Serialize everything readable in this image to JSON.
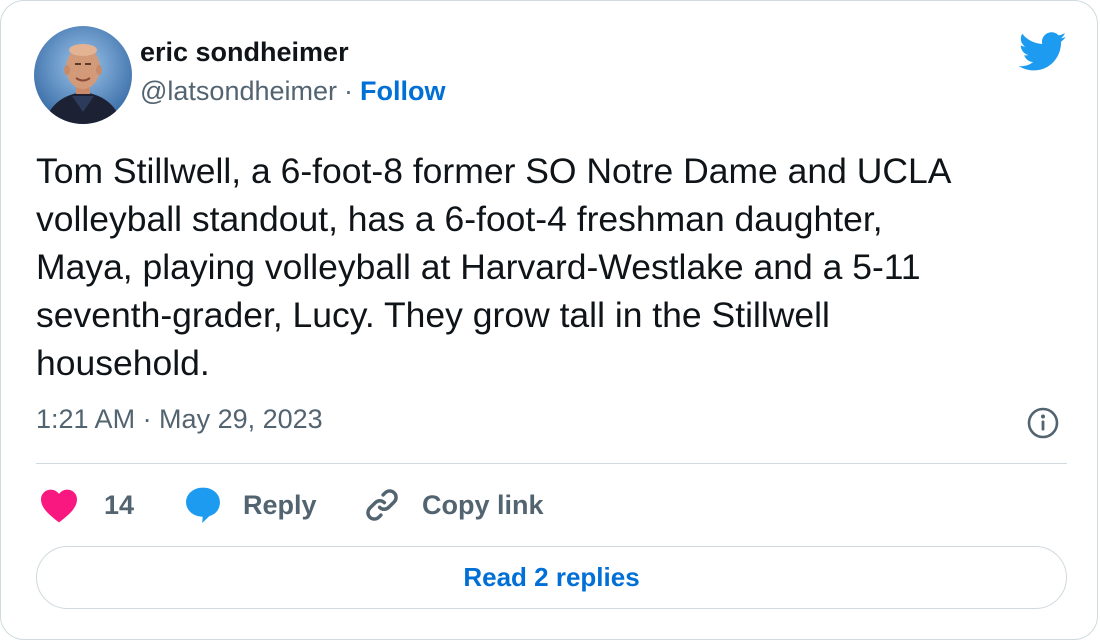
{
  "author": {
    "name": "eric sondheimer",
    "handle": "@latsondheimer",
    "separator": "·",
    "follow_label": "Follow"
  },
  "tweet": {
    "text": "Tom Stillwell, a 6-foot-8 former SO Notre Dame and UCLA\nvolleyball standout, has a 6-foot-4 freshman daughter,\nMaya, playing volleyball at Harvard-Westlake and a 5-11\nseventh-grader, Lucy. They grow tall in the Stillwell\nhousehold.",
    "timestamp": "1:21 AM · May 29, 2023"
  },
  "actions": {
    "like_count": "14",
    "reply_label": "Reply",
    "copy_label": "Copy link"
  },
  "footer": {
    "read_replies_label": "Read 2 replies"
  },
  "icons": {
    "brand": "twitter-bird-icon",
    "info": "info-icon",
    "like": "heart-icon",
    "reply": "speech-bubble-icon",
    "copy": "link-icon"
  },
  "colors": {
    "brand_blue": "#1d9bf0",
    "link_blue": "#006fd6",
    "heart_pink": "#f91880",
    "secondary_text": "#536471",
    "border": "#cfd9de"
  }
}
